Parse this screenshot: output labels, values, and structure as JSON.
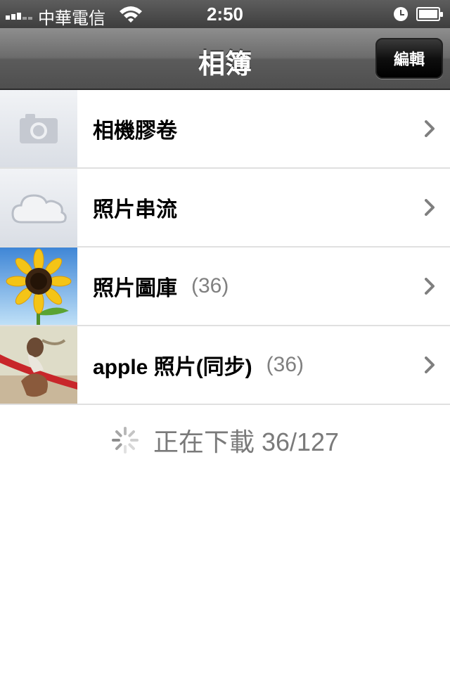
{
  "status_bar": {
    "carrier": "中華電信",
    "time": "2:50",
    "icons": [
      "signal-icon",
      "wifi-icon",
      "alarm-icon",
      "battery-icon"
    ]
  },
  "nav": {
    "title": "相簿",
    "edit_label": "編輯"
  },
  "albums": [
    {
      "label": "相機膠卷",
      "count": "",
      "thumb_icon": "camera-icon"
    },
    {
      "label": "照片串流",
      "count": "",
      "thumb_icon": "cloud-icon"
    },
    {
      "label": "照片圖庫",
      "count": "(36)",
      "thumb_icon": "sunflower-photo"
    },
    {
      "label": "apple 照片(同步)",
      "count": "(36)",
      "thumb_icon": "photo-thumbnail"
    }
  ],
  "download_status": "正在下載 36/127",
  "colors": {
    "navbar": "#6c6c6c",
    "count_text": "#808080",
    "chevron": "#7f7f7f"
  }
}
